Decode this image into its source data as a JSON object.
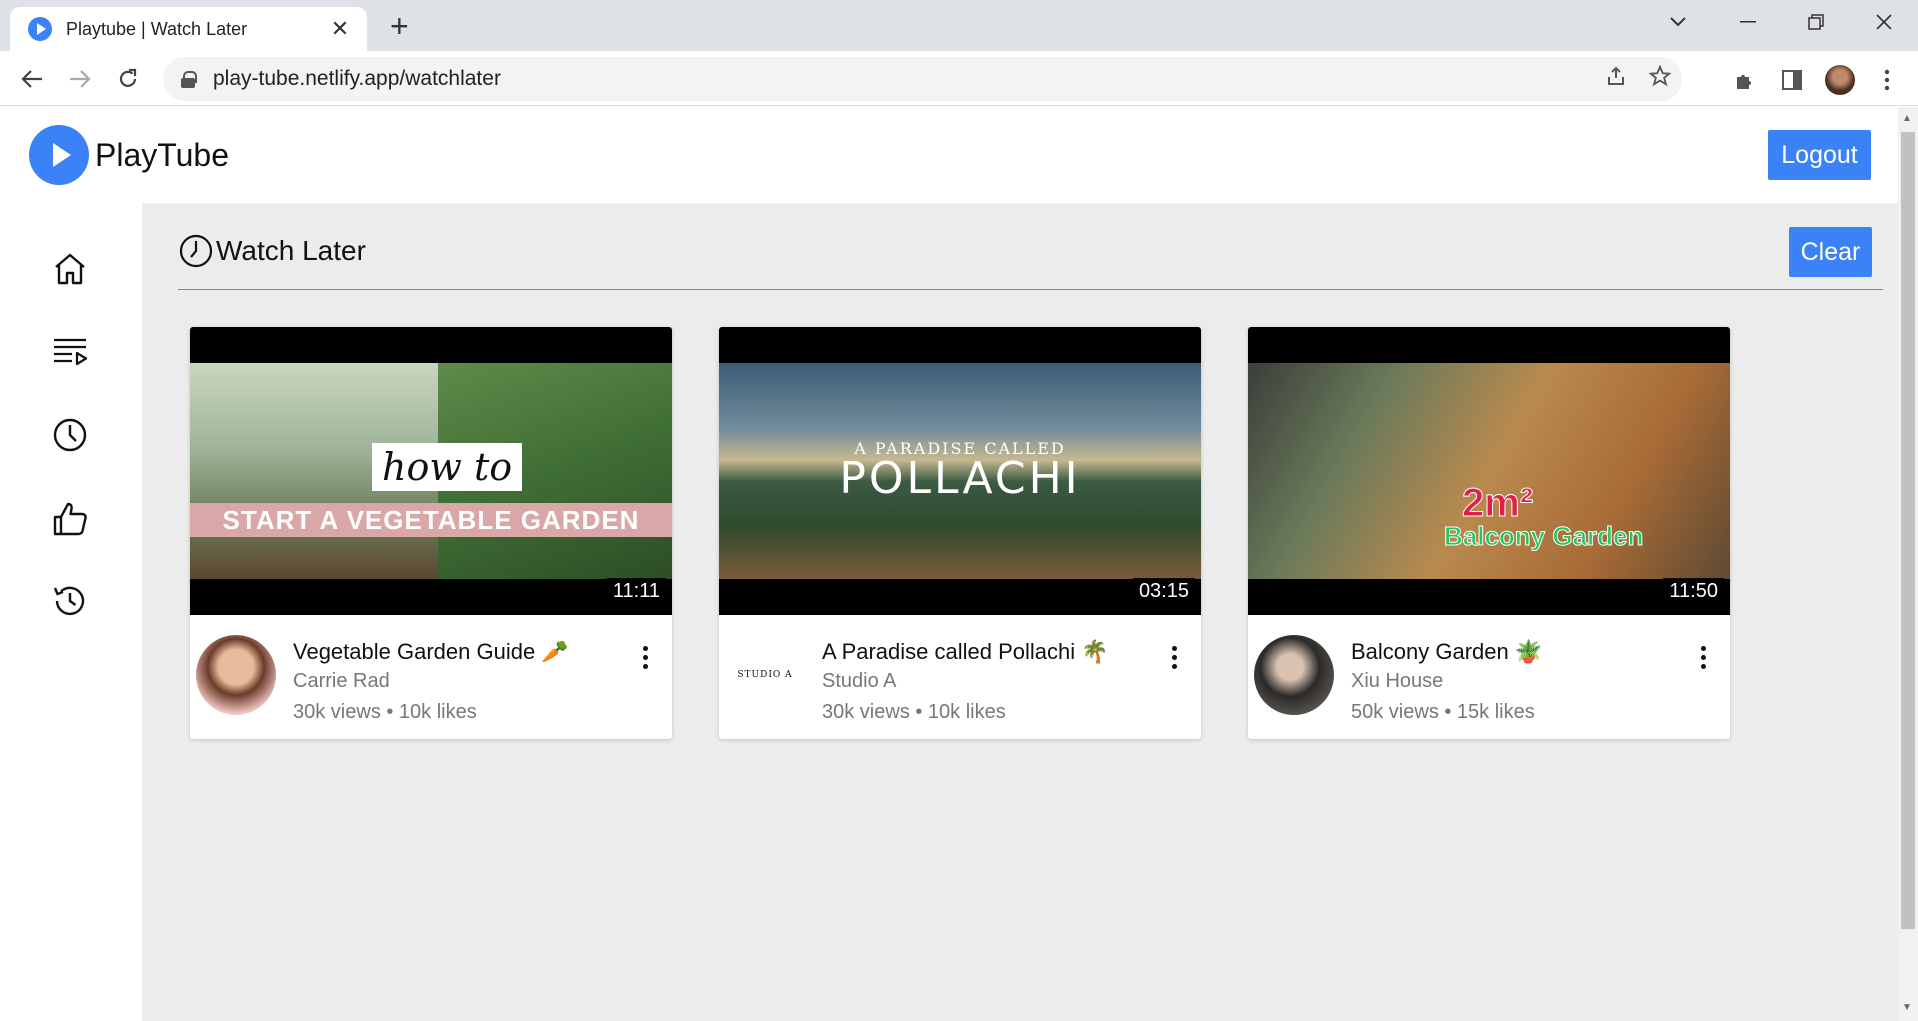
{
  "browser": {
    "tab_title": "Playtube | Watch Later",
    "tab_close": "✕",
    "new_tab": "+",
    "url": "play-tube.netlify.app/watchlater"
  },
  "header": {
    "brand": "PlayTube",
    "logout_label": "Logout"
  },
  "sidebar": {
    "items": [
      {
        "name": "home",
        "icon": "home-icon"
      },
      {
        "name": "playlists",
        "icon": "playlist-icon"
      },
      {
        "name": "watch-later",
        "icon": "clock-icon"
      },
      {
        "name": "liked",
        "icon": "thumbs-up-icon"
      },
      {
        "name": "history",
        "icon": "history-icon"
      }
    ]
  },
  "page": {
    "title": "Watch Later",
    "clear_label": "Clear"
  },
  "videos": [
    {
      "thumb_text_1": "how to",
      "thumb_text_2": "START A VEGETABLE GARDEN",
      "duration": "11:11",
      "title": "Vegetable Garden Guide 🥕",
      "channel": "Carrie Rad",
      "stats": "30k views • 10k likes"
    },
    {
      "thumb_text_1": "A PARADISE CALLED",
      "thumb_text_2": "POLLACHI",
      "avatar_text": "STUDIO A",
      "duration": "03:15",
      "title": "A Paradise called Pollachi 🌴",
      "channel": "Studio A",
      "stats": "30k views • 10k likes"
    },
    {
      "thumb_text_1": "2m²",
      "thumb_text_2": "Balcony Garden",
      "duration": "11:50",
      "title": "Balcony Garden 🪴",
      "channel": "Xiu House",
      "stats": "50k views • 15k likes"
    }
  ],
  "colors": {
    "accent": "#3b82f6",
    "main_bg": "#ececec"
  }
}
